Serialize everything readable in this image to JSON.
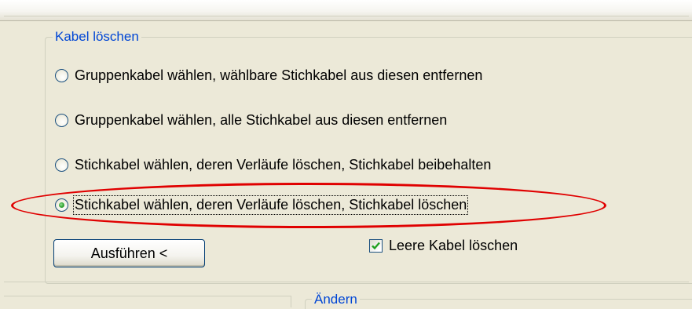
{
  "group": {
    "legend": "Kabel löschen"
  },
  "options": [
    {
      "label": "Gruppenkabel wählen, wählbare Stichkabel aus diesen entfernen",
      "checked": false
    },
    {
      "label": "Gruppenkabel wählen, alle Stichkabel aus diesen entfernen",
      "checked": false
    },
    {
      "label": "Stichkabel wählen, deren Verläufe löschen, Stichkabel beibehalten",
      "checked": false
    },
    {
      "label": "Stichkabel wählen, deren Verläufe löschen, Stichkabel löschen",
      "checked": true
    }
  ],
  "execute_button": {
    "label": "Ausführen <"
  },
  "empty_cables_checkbox": {
    "label": "Leere Kabel löschen",
    "checked": true
  },
  "bottom_group": {
    "legend": "Ändern"
  },
  "colors": {
    "legend_text": "#0046d5",
    "highlight_ellipse": "#e00000",
    "panel_background": "#ece9d8"
  }
}
